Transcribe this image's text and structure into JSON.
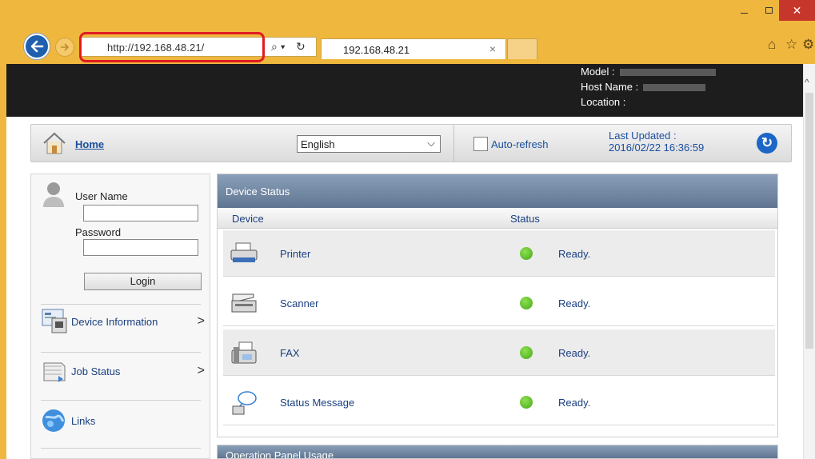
{
  "browser": {
    "window_controls": {
      "minimize": "–",
      "maximize": "□",
      "close": "✕"
    },
    "address": {
      "url": "http://192.168.48.21/"
    },
    "tab": {
      "title": "192.168.48.21",
      "close": "×"
    },
    "icons": {
      "back": "back-arrow-icon",
      "forward": "forward-arrow-icon",
      "home": "home-icon",
      "favorites": "star-icon",
      "tools": "gear-icon"
    }
  },
  "header": {
    "model_label": "Model :",
    "host_label": "Host Name :",
    "location_label": "Location :"
  },
  "topbar": {
    "home": "Home",
    "language": "English",
    "auto_refresh": "Auto-refresh",
    "last_updated_label": "Last Updated :",
    "last_updated_value": "2016/02/22 16:36:59"
  },
  "sidebar": {
    "user_name_label": "User Name",
    "password_label": "Password",
    "login": "Login",
    "items": [
      {
        "label": "Device Information",
        "chevron": ">"
      },
      {
        "label": "Job Status",
        "chevron": ">"
      },
      {
        "label": "Links"
      }
    ]
  },
  "device_status": {
    "title": "Device Status",
    "columns": [
      "Device",
      "Status"
    ],
    "rows": [
      {
        "device": "Printer",
        "status": "Ready."
      },
      {
        "device": "Scanner",
        "status": "Ready."
      },
      {
        "device": "FAX",
        "status": "Ready."
      },
      {
        "device": "Status Message",
        "status": "Ready."
      }
    ]
  },
  "next_panel": {
    "title": "Operation Panel Usage"
  },
  "colors": {
    "titlebar": "#f0b73f",
    "accent_blue": "#1a4fa0",
    "status_green": "#46a81a",
    "panel_header": "#6f84a0",
    "close_red": "#c7362a"
  }
}
